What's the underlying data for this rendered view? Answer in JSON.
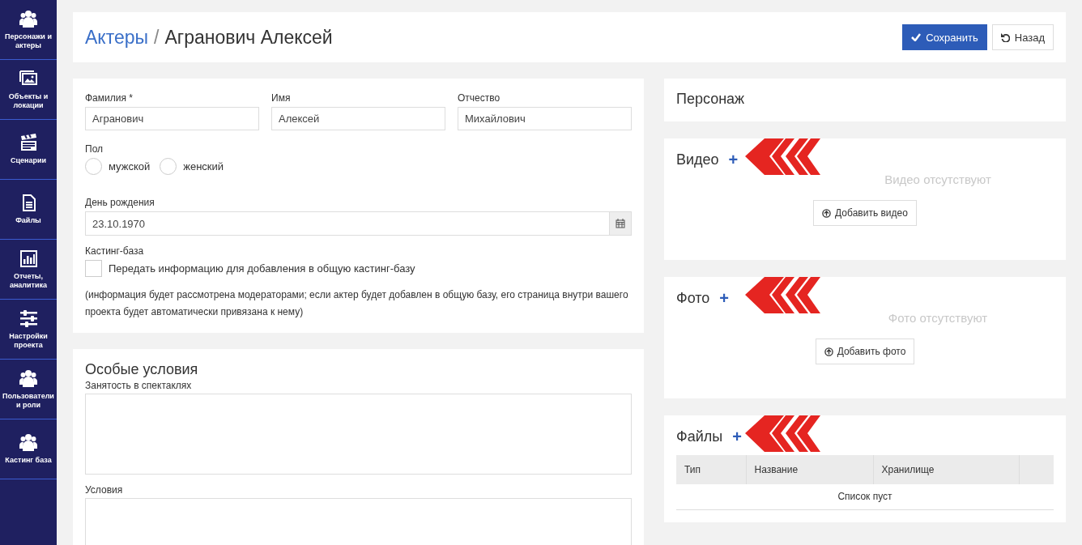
{
  "sidebar": {
    "items": [
      {
        "label": "Персонажи и актеры"
      },
      {
        "label": "Объекты и локации"
      },
      {
        "label": "Сценарии"
      },
      {
        "label": "Файлы"
      },
      {
        "label": "Отчеты, аналитика"
      },
      {
        "label": "Настройки проекта"
      },
      {
        "label": "Пользователи и роли"
      },
      {
        "label": "Кастинг база"
      }
    ]
  },
  "header": {
    "breadcrumb_parent": "Актеры",
    "separator": "/",
    "title": "Агранович Алексей",
    "buttons": [
      {
        "label": "Сохранить",
        "kind": "primary"
      },
      {
        "label": "Назад",
        "kind": "default"
      }
    ]
  },
  "main_form": {
    "name_fields": [
      {
        "label": "Фамилия",
        "required_mark": "*",
        "value": "Агранович"
      },
      {
        "label": "Имя",
        "value": "Алексей"
      },
      {
        "label": "Отчество",
        "value": "Михайлович"
      }
    ],
    "gender": {
      "label": "Пол",
      "options": [
        {
          "label": "мужской",
          "selected": false
        },
        {
          "label": "женский",
          "selected": false
        }
      ]
    },
    "birthday": {
      "label": "День рождения",
      "value": "23.10.1970"
    },
    "casting": {
      "label": "Кастинг-база",
      "checkbox_label": "Передать информацию для добавления в общую кастинг-базу",
      "checked": false,
      "note": "(информация будет рассмотрена модераторами; если актер будет добавлен в общую базу, его страница внутри вашего проекта будет автоматически привязана к нему)"
    }
  },
  "special_conditions": {
    "title": "Особые условия",
    "fields": [
      {
        "label": "Занятость в спектаклях"
      },
      {
        "label": "Условия"
      }
    ]
  },
  "character": {
    "title": "Персонаж"
  },
  "video": {
    "title": "Видео",
    "add": "+",
    "empty": "Видео отсутствуют",
    "button": "Добавить видео"
  },
  "photo": {
    "title": "Фото",
    "add": "+",
    "empty": "Фото отсутствуют",
    "button": "Добавить фото"
  },
  "files": {
    "title": "Файлы",
    "add": "+",
    "columns": [
      "Тип",
      "Название",
      "Хранилище"
    ],
    "empty": "Список пуст"
  }
}
